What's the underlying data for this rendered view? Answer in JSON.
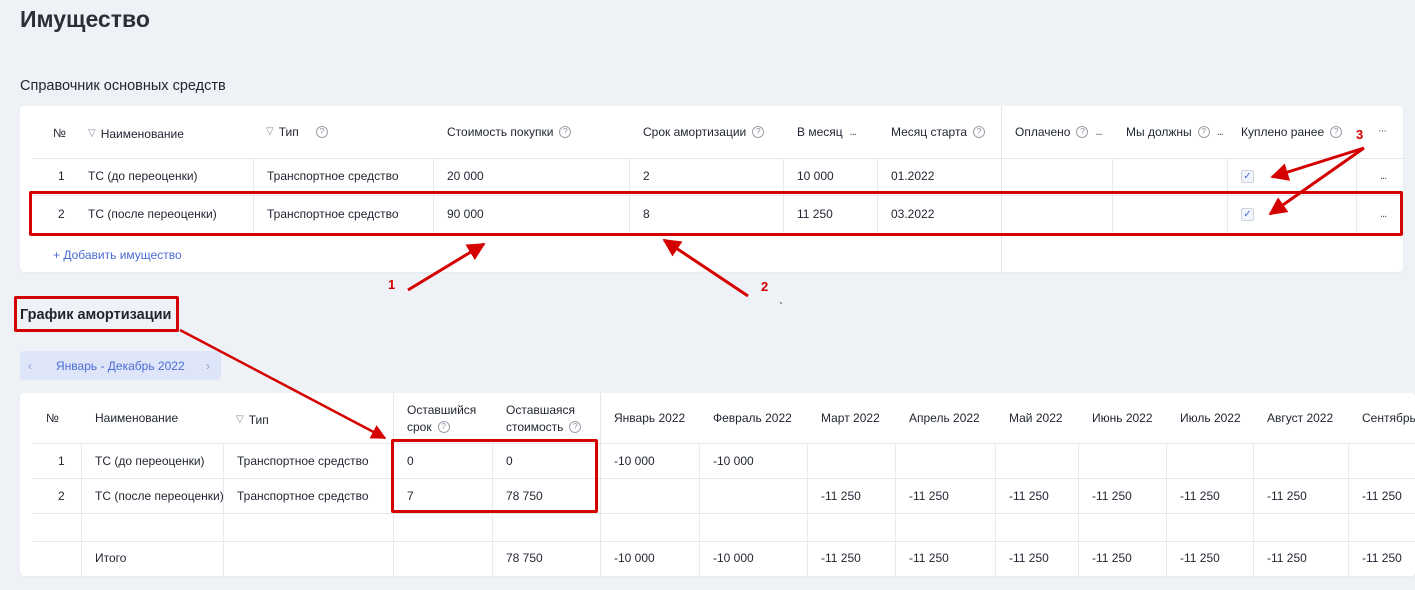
{
  "page": {
    "title": "Имущество"
  },
  "assets": {
    "title": "Справочник основных средств",
    "columns": {
      "num": "№",
      "name": "Наименование",
      "type": "Тип",
      "cost": "Стоимость покупки",
      "term": "Срок амортизации",
      "per_month": "В месяц",
      "start_month": "Месяц старта",
      "paid": "Оплачено",
      "we_owe": "Мы должны",
      "bought_before": "Куплено ранее",
      "more": "···"
    },
    "rows": [
      {
        "num": "1",
        "name": "ТС (до переоценки)",
        "type": "Транспортное средство",
        "cost": "20 000",
        "term": "2",
        "per_month": "10 000",
        "start_month": "01.2022",
        "bought_before": true,
        "more": "..."
      },
      {
        "num": "2",
        "name": "ТС (после переоценки)",
        "type": "Транспортное средство",
        "cost": "90 000",
        "term": "8",
        "per_month": "11 250",
        "start_month": "03.2022",
        "bought_before": true,
        "more": "..."
      }
    ],
    "add_label": "+ Добавить имущество",
    "help_glyph": "?",
    "check_glyph": "✓",
    "filter_glyph": "▽",
    "ellipsis_glyph": "..."
  },
  "schedule": {
    "title": "График амортизации",
    "range_label": "Январь - Декабрь 2022",
    "prev_glyph": "‹",
    "next_glyph": "›",
    "columns": {
      "num": "№",
      "name": "Наименование",
      "type": "Тип",
      "remaining_term_line1": "Оставшийся",
      "remaining_term_line2": "срок",
      "remaining_cost_line1": "Оставшаяся",
      "remaining_cost_line2": "стоимость",
      "months": [
        "Январь 2022",
        "Февраль 2022",
        "Март 2022",
        "Апрель 2022",
        "Май 2022",
        "Июнь 2022",
        "Июль 2022",
        "Август 2022",
        "Сентябрь"
      ]
    },
    "rows": [
      {
        "num": "1",
        "name": "ТС (до переоценки)",
        "type": "Транспортное средство",
        "remaining_term": "0",
        "remaining_cost": "0",
        "months": [
          "-10 000",
          "-10 000",
          "",
          "",
          "",
          "",
          "",
          "",
          ""
        ]
      },
      {
        "num": "2",
        "name": "ТС (после переоценки)",
        "type": "Транспортное средство",
        "remaining_term": "7",
        "remaining_cost": "78 750",
        "months": [
          "",
          "",
          "-11 250",
          "-11 250",
          "-11 250",
          "-11 250",
          "-11 250",
          "-11 250",
          "-11 250"
        ]
      }
    ],
    "total": {
      "label": "Итого",
      "remaining_cost": "78 750",
      "months": [
        "-10 000",
        "-10 000",
        "-11 250",
        "-11 250",
        "-11 250",
        "-11 250",
        "-11 250",
        "-11 250",
        "-11 250"
      ]
    }
  },
  "annotations": {
    "a1": "1",
    "a2": "2",
    "a3": "3",
    "tick": "`"
  },
  "colors": {
    "accent": "#4a6cd6",
    "annotation": "#d40000",
    "background": "#eef1f5"
  }
}
